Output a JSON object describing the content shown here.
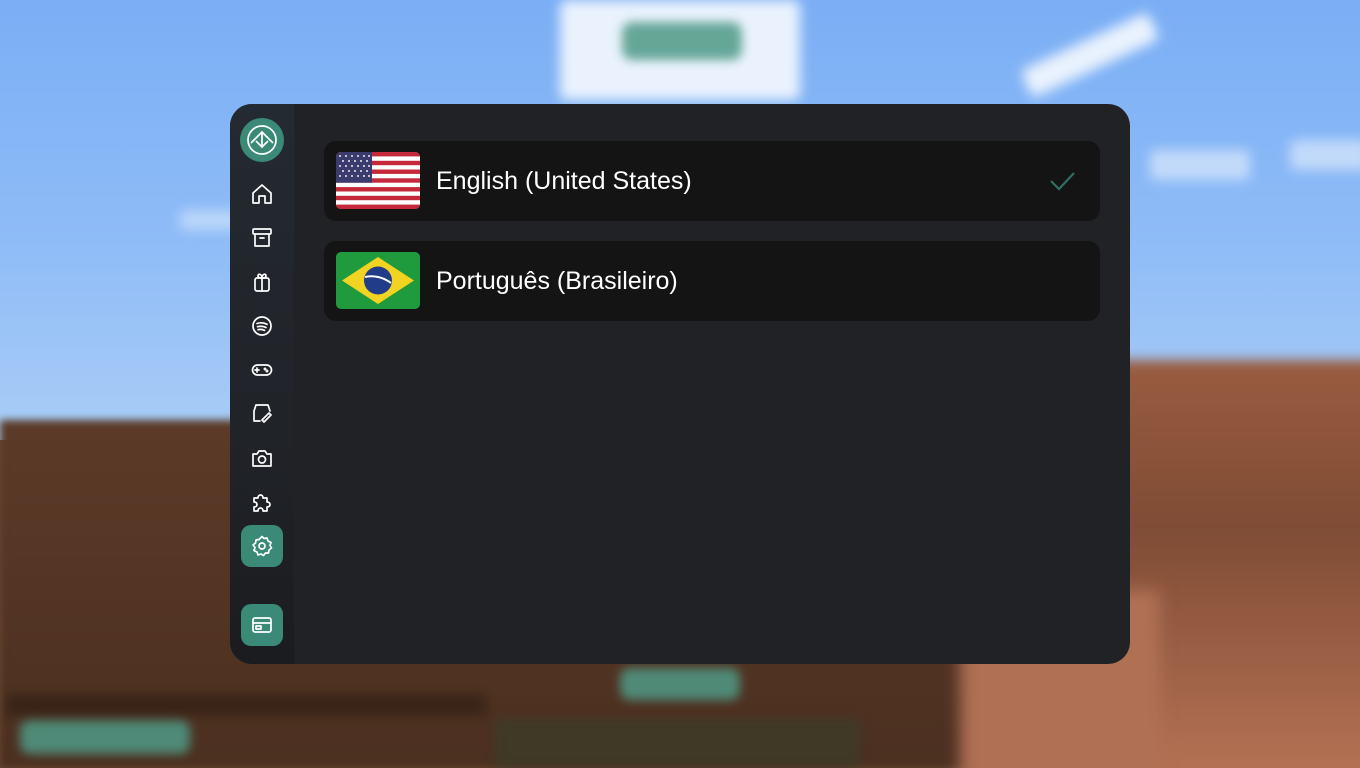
{
  "nav": {
    "items": [
      {
        "name": "home-icon"
      },
      {
        "name": "archive-icon"
      },
      {
        "name": "gift-icon"
      },
      {
        "name": "spotify-icon"
      },
      {
        "name": "gamepad-icon"
      },
      {
        "name": "cosmetics-pencil-icon"
      },
      {
        "name": "camera-icon"
      },
      {
        "name": "puzzle-icon"
      },
      {
        "name": "gear-icon",
        "active": true
      }
    ],
    "bottom": {
      "name": "hud-editor-icon"
    }
  },
  "languages": [
    {
      "label": "English (United States)",
      "flag": "us-flag-icon",
      "selected": true
    },
    {
      "label": "Português (Brasileiro)",
      "flag": "br-flag-icon",
      "selected": false
    }
  ],
  "colors": {
    "accent": "#3b8a78",
    "panel_bg": "#212226",
    "row_bg": "#141414",
    "check": "#2f6e62"
  }
}
